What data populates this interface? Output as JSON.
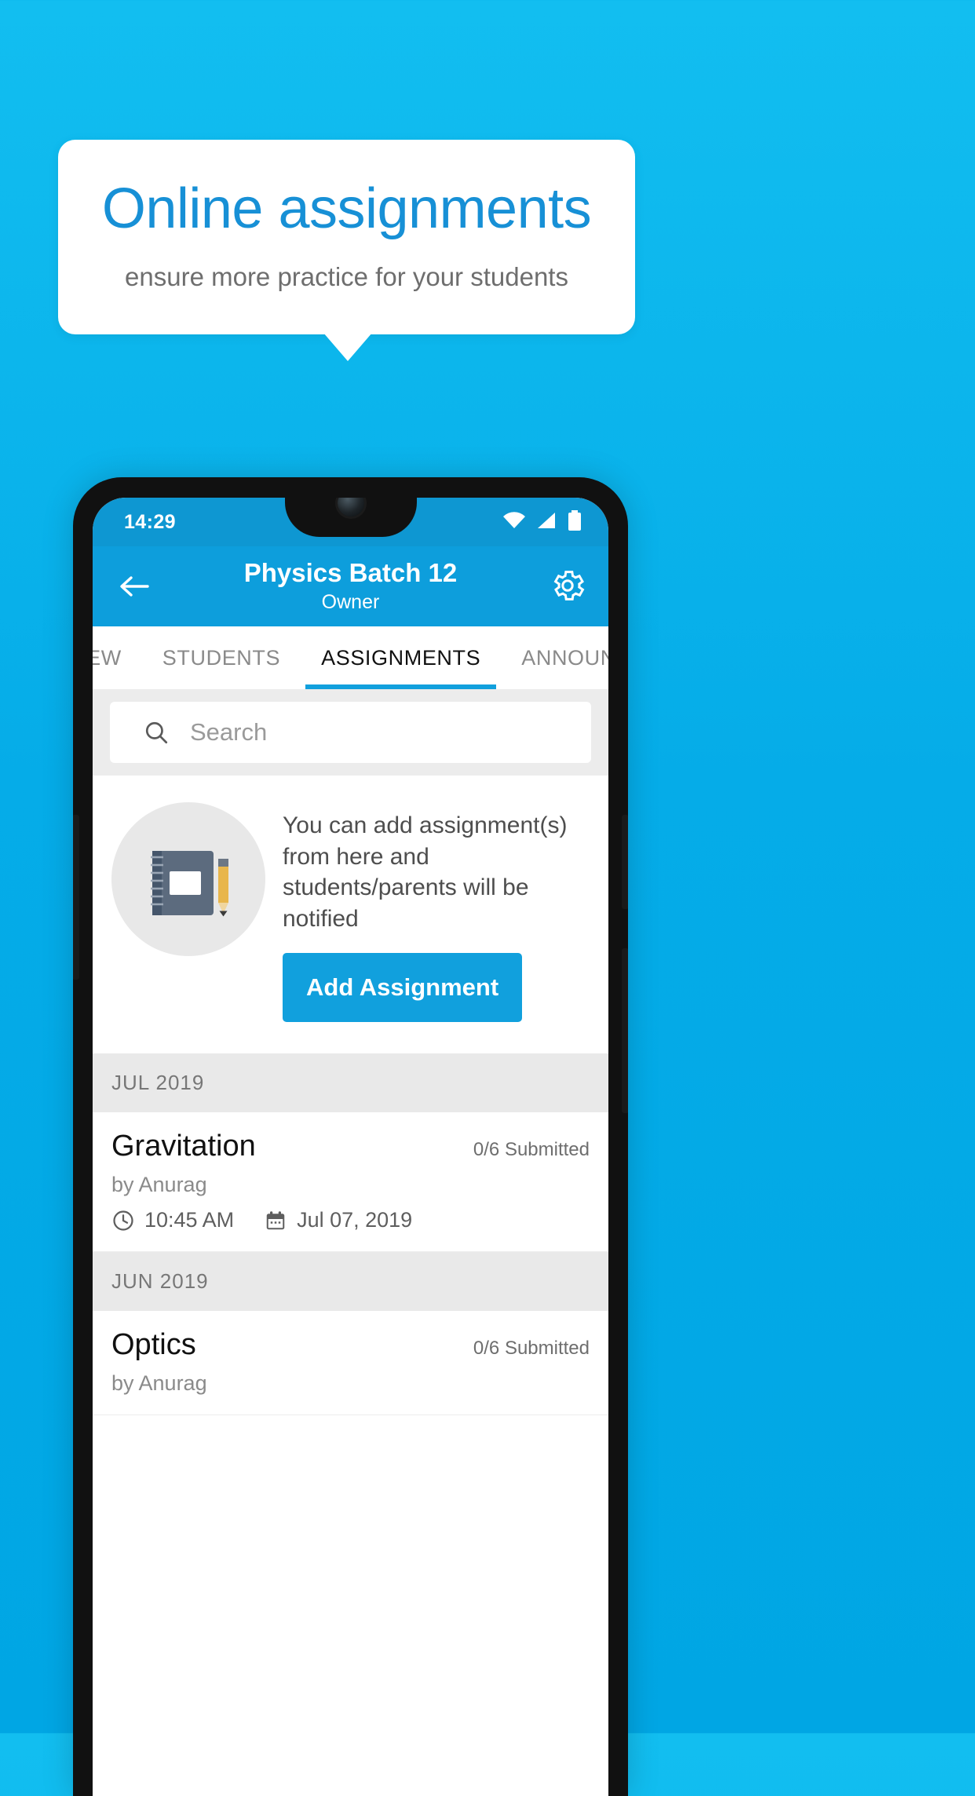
{
  "promo": {
    "title": "Online assignments",
    "subtitle": "ensure more practice for your students",
    "title_color": "#1790D6",
    "subtitle_color": "#6E6E6E",
    "background_color": "#05ACE8"
  },
  "phone": {
    "status_bar": {
      "time": "14:29",
      "icons": [
        "wifi-icon",
        "signal-icon",
        "battery-icon"
      ],
      "background_color": "#0E97D2"
    },
    "app_bar": {
      "back_icon": "back-arrow-icon",
      "title": "Physics Batch 12",
      "subtitle": "Owner",
      "settings_icon": "gear-icon",
      "background_color": "#0D9EDC"
    },
    "tabs": [
      {
        "label": "IEW",
        "active": false
      },
      {
        "label": "STUDENTS",
        "active": false
      },
      {
        "label": "ASSIGNMENTS",
        "active": true
      },
      {
        "label": "ANNOUNCEM",
        "active": false
      }
    ],
    "tab_indicator_color": "#11A0DD",
    "search": {
      "icon": "search-icon",
      "placeholder": "Search",
      "value": ""
    },
    "empty_state": {
      "illustration_icon": "notebook-pencil-icon",
      "text": "You can add assignment(s) from here and students/parents will be notified",
      "button_label": "Add Assignment",
      "button_color": "#11A0DD"
    },
    "sections": [
      {
        "month": "JUL 2019",
        "items": [
          {
            "title": "Gravitation",
            "submitted": "0/6 Submitted",
            "author": "by Anurag",
            "time_icon": "clock-icon",
            "time": "10:45 AM",
            "date_icon": "calendar-icon",
            "date": "Jul 07, 2019"
          }
        ]
      },
      {
        "month": "JUN 2019",
        "items": [
          {
            "title": "Optics",
            "submitted": "0/6 Submitted",
            "author": "by Anurag",
            "time_icon": "clock-icon",
            "time": "",
            "date_icon": "calendar-icon",
            "date": ""
          }
        ]
      }
    ]
  }
}
